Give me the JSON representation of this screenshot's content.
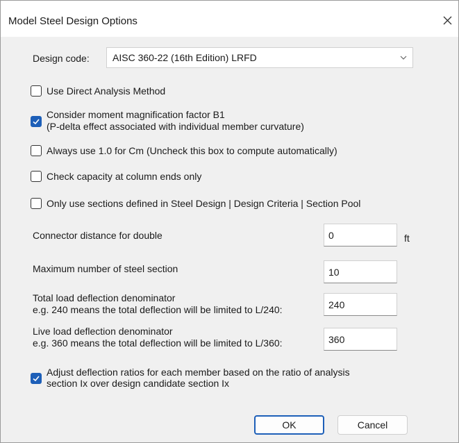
{
  "window": {
    "title": "Model Steel Design Options"
  },
  "design_code": {
    "label": "Design code:",
    "value": "AISC 360-22 (16th Edition) LRFD"
  },
  "checkboxes": [
    {
      "lines": [
        "Use Direct Analysis Method"
      ],
      "checked": false
    },
    {
      "lines": [
        "Consider moment magnification factor B1",
        "(P-delta effect associated with individual member curvature)"
      ],
      "checked": true
    },
    {
      "lines": [
        "Always use 1.0 for Cm (Uncheck this box to compute automatically)"
      ],
      "checked": false
    },
    {
      "lines": [
        "Check capacity at column ends only"
      ],
      "checked": false
    },
    {
      "lines": [
        "Only use sections defined in Steel Design | Design Criteria | Section Pool"
      ],
      "checked": false
    }
  ],
  "fields": [
    {
      "lines": [
        "Connector distance for double"
      ],
      "value": "0",
      "unit": "ft"
    },
    {
      "lines": [
        "Maximum number of steel section"
      ],
      "value": "10"
    },
    {
      "lines": [
        "Total load deflection denominator",
        "e.g. 240 means the total deflection will be limited to L/240:"
      ],
      "value": "240"
    },
    {
      "lines": [
        "Live load deflection denominator",
        "e.g. 360 means the total deflection will be limited to L/360:"
      ],
      "value": "360"
    }
  ],
  "adjust": {
    "lines": [
      "Adjust deflection ratios for each member based on the ratio of analysis",
      "section Ix over design candidate section Ix"
    ],
    "checked": true
  },
  "buttons": {
    "ok": "OK",
    "cancel": "Cancel"
  },
  "icons": {
    "close": "close-icon",
    "dropdown": "chevron-down-icon",
    "check": "checkmark-icon"
  },
  "colors": {
    "accent": "#1d5fb8",
    "dialog_bg": "#f0f0f0"
  }
}
